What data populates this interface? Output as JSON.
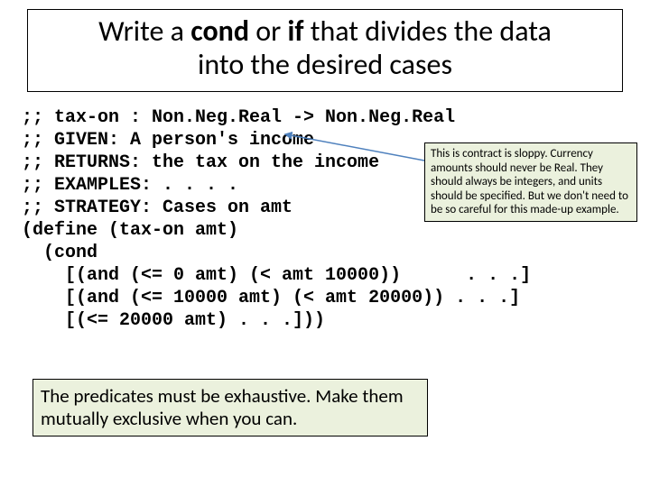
{
  "title": {
    "pre1": "Write a ",
    "b1": "cond",
    "mid": " or ",
    "b2": "if",
    "post": " that divides the data",
    "line2": "into the desired cases"
  },
  "code": {
    "l1": ";; tax-on : Non.Neg.Real -> Non.Neg.Real",
    "l2": ";; GIVEN: A person's income",
    "l3": ";; RETURNS: the tax on the income",
    "l4": ";; EXAMPLES: . . . .",
    "l5": ";; STRATEGY: Cases on amt",
    "l6": "(define (tax-on amt)",
    "l7": "  (cond",
    "l8": "    [(and (<= 0 amt) (< amt 10000))      . . .]",
    "l9": "    [(and (<= 10000 amt) (< amt 20000)) . . .]",
    "l10": "    [(<= 20000 amt) . . .]))"
  },
  "annotation": "This is contract is sloppy. Currency amounts should never be Real. They should always be integers, and units should be specified.  But we don't need to be so careful for this made-up example.",
  "note": "The predicates must be exhaustive.  Make them mutually exclusive when you can."
}
